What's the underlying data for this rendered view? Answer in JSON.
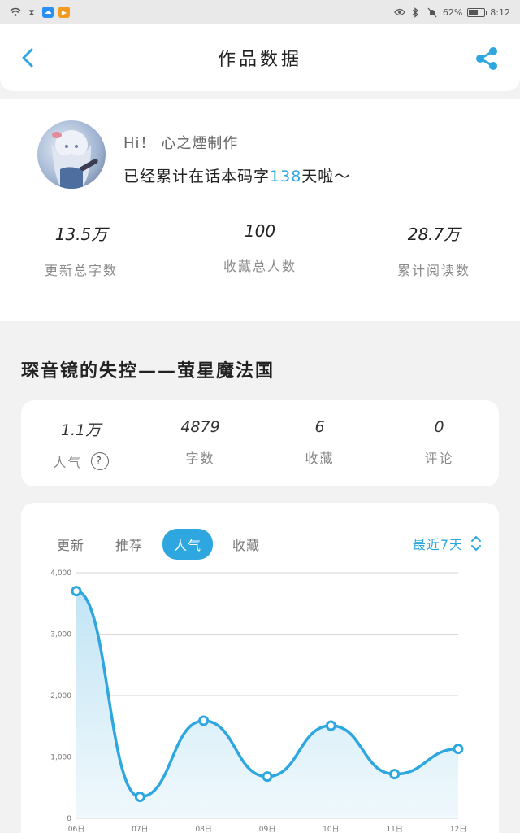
{
  "status_bar": {
    "battery": "62%",
    "time": "8:12",
    "battery_level": 0.62
  },
  "nav": {
    "title": "作品数据"
  },
  "profile": {
    "greeting": "Hi！ 心之煙制作",
    "days_prefix": "已经累计在话本码字",
    "days_value": "138",
    "days_suffix": "天啦～"
  },
  "author_stats": [
    {
      "value": "13.5万",
      "label": "更新总字数"
    },
    {
      "value": "100",
      "label": "收藏总人数"
    },
    {
      "value": "28.7万",
      "label": "累计阅读数"
    }
  ],
  "book": {
    "title": "琛音镜的失控——萤星魔法国",
    "stats": [
      {
        "value": "1.1万",
        "label": "人气"
      },
      {
        "value": "4879",
        "label": "字数"
      },
      {
        "value": "6",
        "label": "收藏"
      },
      {
        "value": "0",
        "label": "评论"
      }
    ]
  },
  "chart_tabs": [
    "更新",
    "推荐",
    "人气",
    "收藏"
  ],
  "chart_active_tab": "人气",
  "chart_range": "最近7天",
  "colors": {
    "accent": "#2ea7e0",
    "fill_top": "#bfe3f4",
    "fill_bottom": "#eef8fc"
  },
  "chart_data": {
    "type": "line",
    "categories": [
      "06日",
      "07日",
      "08日",
      "09日",
      "10日",
      "11日",
      "12日"
    ],
    "values": [
      3700,
      350,
      1590,
      680,
      1510,
      720,
      1130
    ],
    "yticks": [
      "0",
      "1,000",
      "2,000",
      "3,000",
      "4,000"
    ],
    "ylim": [
      0,
      4000
    ],
    "grid": true,
    "smooth": true,
    "area_fill": true
  }
}
